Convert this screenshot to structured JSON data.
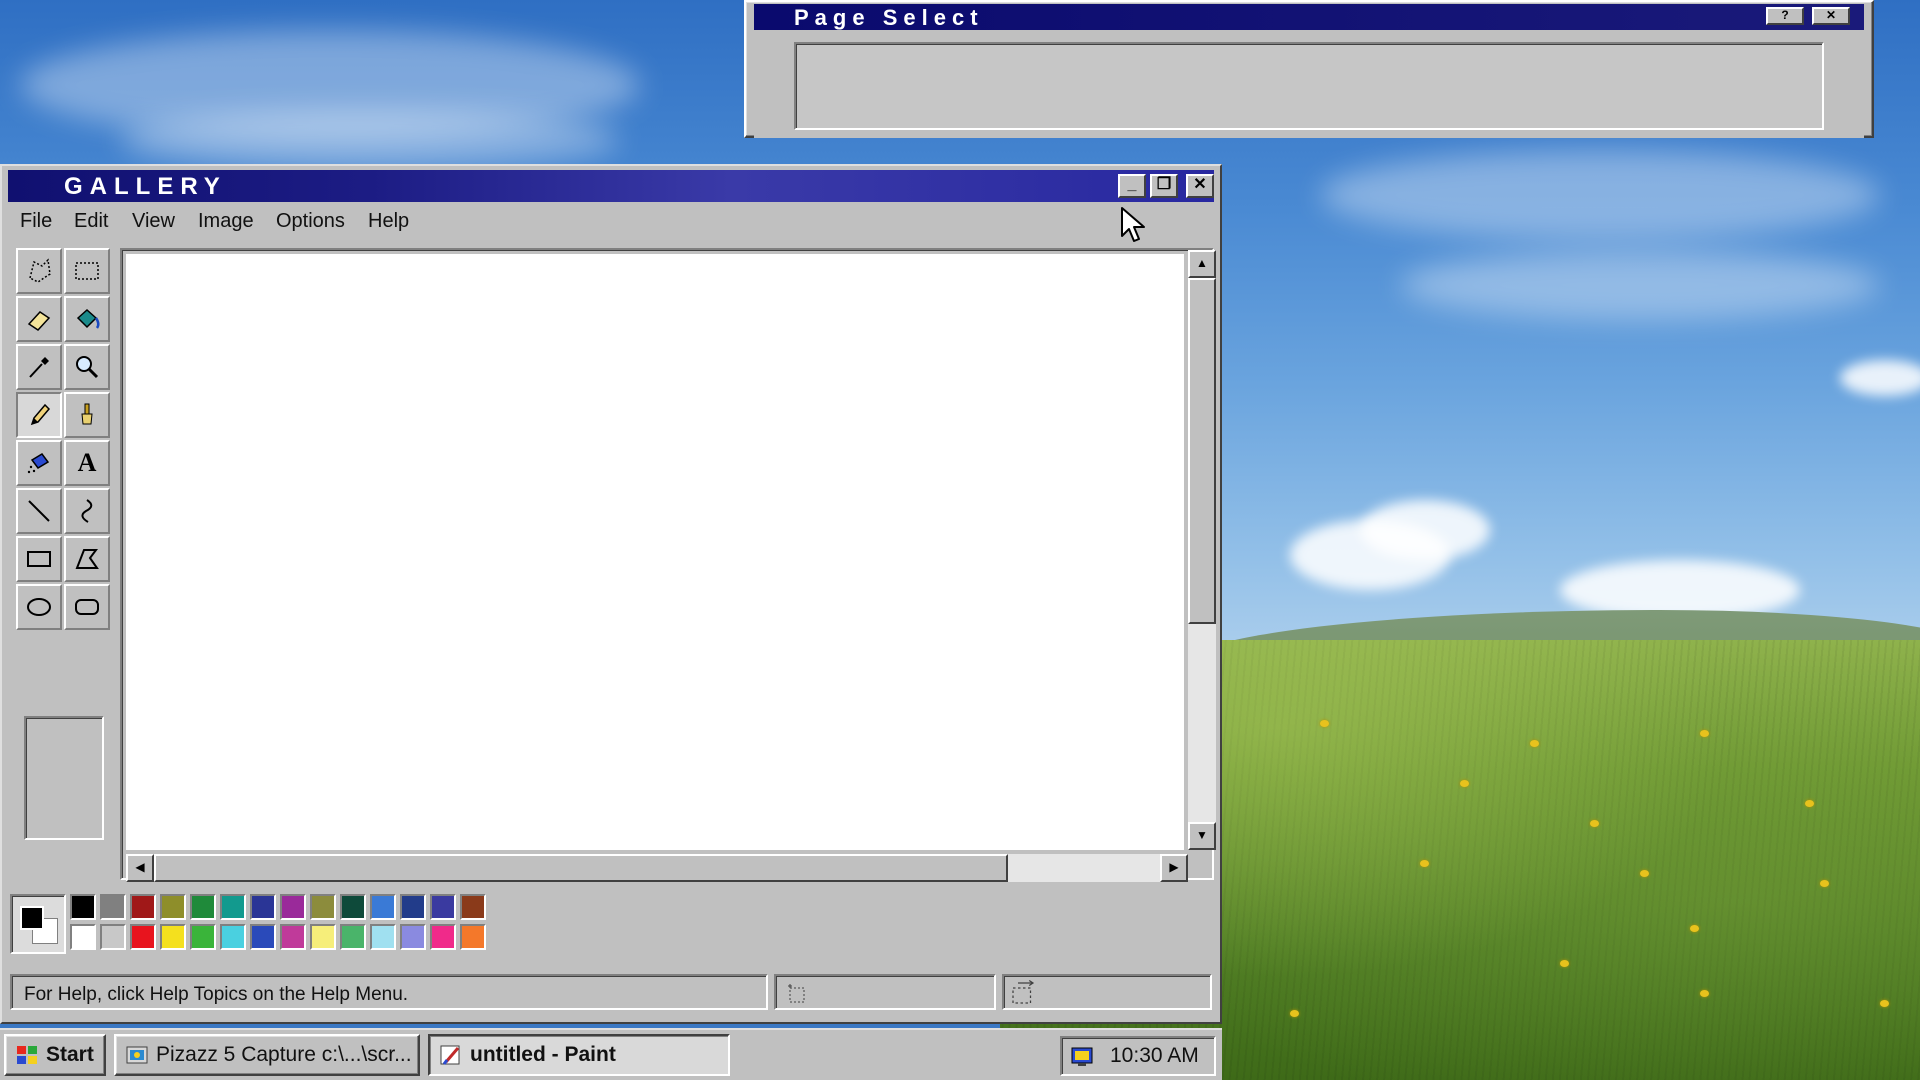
{
  "page_select": {
    "title": "Page Select",
    "help_button": "?",
    "close_button": "✕"
  },
  "paint": {
    "title": "GALLERY",
    "window_buttons": {
      "minimize": "_",
      "restore": "❐",
      "close": "✕"
    },
    "menu": [
      "File",
      "Edit",
      "View",
      "Image",
      "Options",
      "Help"
    ],
    "tools": [
      "free-form-select",
      "select",
      "eraser",
      "fill-with-color",
      "pick-color",
      "magnifier",
      "pencil",
      "brush",
      "airbrush",
      "text",
      "line",
      "curve",
      "rectangle",
      "polygon",
      "ellipse",
      "rounded-rectangle"
    ],
    "active_tool": "pencil",
    "text_tool_glyph": "A",
    "palette": {
      "foreground": "#000000",
      "background": "#ffffff",
      "row1": [
        "#000000",
        "#808080",
        "#a01818",
        "#8e8e2a",
        "#1f8a3a",
        "#129a8e",
        "#2a3596",
        "#9a2a9a",
        "#8c8c3c",
        "#0e4a3a",
        "#3a7ad6",
        "#223c8a",
        "#3a3aa0",
        "#8a3a1a"
      ],
      "row2": [
        "#ffffff",
        "#c8c8c8",
        "#e8141e",
        "#f4e01e",
        "#3ab43a",
        "#4ad0e0",
        "#2a4aba",
        "#c03a9a",
        "#f6ee7a",
        "#4ab46a",
        "#a0e0f0",
        "#8a8ae0",
        "#f02a8a",
        "#f4782a"
      ]
    },
    "status_text": "For Help, click Help Topics on the Help Menu."
  },
  "taskbar": {
    "start_label": "Start",
    "tasks": [
      {
        "label": "Pizazz 5 Capture c:\\...\\scr...",
        "pressed": false
      },
      {
        "label": "untitled - Paint",
        "pressed": true
      }
    ],
    "clock": "10:30 AM"
  },
  "colors": {
    "title_active": "#101070",
    "face": "#c0c0c0",
    "canvas": "#ffffff"
  }
}
